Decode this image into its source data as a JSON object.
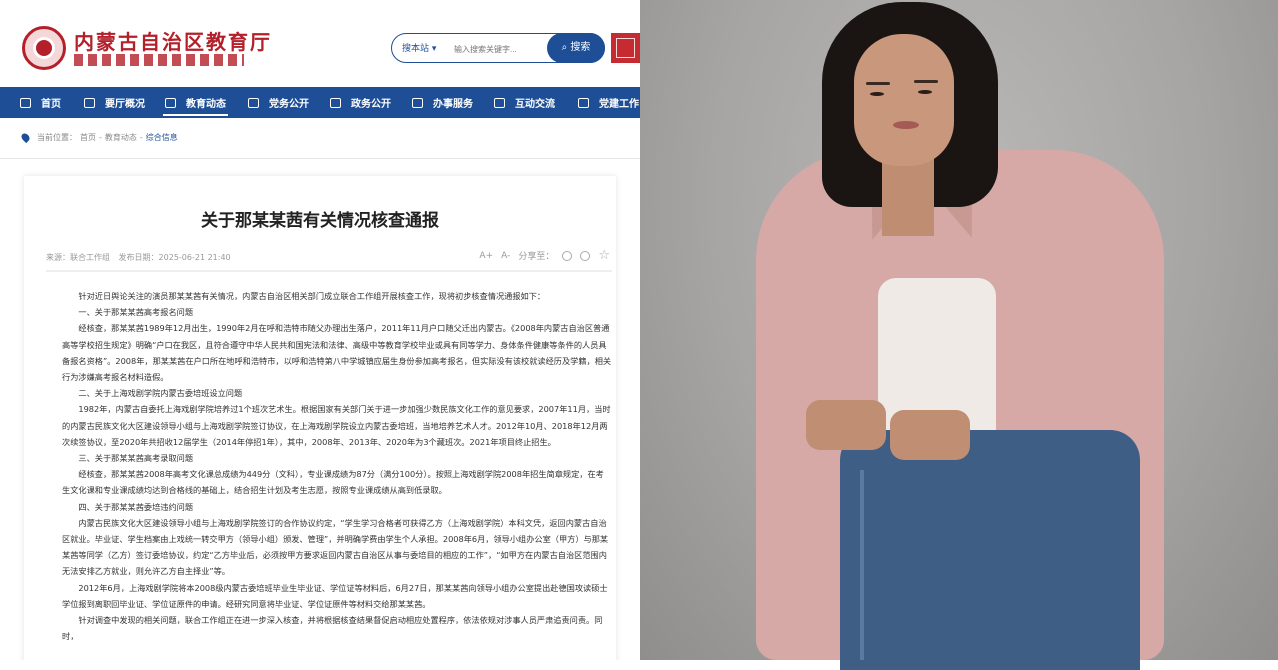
{
  "site": {
    "name": "内蒙古自治区教育厅",
    "search": {
      "scope": "搜本站 ▾",
      "placeholder": "输入搜索关键字...",
      "button": "搜索"
    }
  },
  "nav": [
    "首页",
    "要厅概况",
    "教育动态",
    "党务公开",
    "政务公开",
    "办事服务",
    "互动交流",
    "党建工作"
  ],
  "breadcrumb": {
    "label": "当前位置：",
    "path1": "首页",
    "sep": "-",
    "path2": "教育动态",
    "path3": "综合信息"
  },
  "article": {
    "title": "关于那某某茜有关情况核查通报",
    "meta": {
      "source": "来源：联合工作组",
      "date": "发布日期：2025-06-21 21:40"
    },
    "tools": {
      "font_up": "A+",
      "font_down": "A-",
      "share": "分享至："
    },
    "paragraphs": [
      "针对近日舆论关注的演员那某某茜有关情况，内蒙古自治区相关部门成立联合工作组开展核查工作，现将初步核查情况通报如下：",
      "一、关于那某某茜高考报名问题",
      "经核查，那某某茜1989年12月出生，1990年2月在呼和浩特市随父办理出生落户，2011年11月户口随父迁出内蒙古。《2008年内蒙古自治区普通高等学校招生规定》明确“户口在我区，且符合遵守中华人民共和国宪法和法律、高级中等教育学校毕业或具有同等学力、身体条件健康等条件的人员具备报名资格”。2008年，那某某茜在户口所在地呼和浩特市，以呼和浩特第八中学城镇应届生身份参加高考报名，但实际没有该校就读经历及学籍，相关行为涉嫌高考报名材料造假。",
      "二、关于上海戏剧学院内蒙古委培班设立问题",
      "1982年，内蒙古自委托上海戏剧学院培养过1个班次艺术生。根据国家有关部门关于进一步加强少数民族文化工作的意见要求，2007年11月，当时的内蒙古民族文化大区建设领导小组与上海戏剧学院签订协议，在上海戏剧学院设立内蒙古委培班，当地培养艺术人才。2012年10月、2018年12月两次续签协议，至2020年共招收12届学生（2014年停招1年），其中，2008年、2013年、2020年为3个藏班次。2021年项目终止招生。",
      "三、关于那某某茜高考录取问题",
      "经核查，那某某茜2008年高考文化课总成绩为449分（文科），专业课成绩为87分（满分100分）。按照上海戏剧学院2008年招生简章规定，在考生文化课和专业课成绩均达到合格线的基础上，结合招生计划及考生志愿，按照专业课成绩从高到低录取。",
      "四、关于那某某茜委培违约问题",
      "内蒙古民族文化大区建设领导小组与上海戏剧学院签订的合作协议约定，“学生学习合格者可获得乙方（上海戏剧学院）本科文凭，返回内蒙古自治区就业。毕业证、学生档案由上戏统一转交甲方（领导小组）颁发、管理”，并明确学费由学生个人承担。2008年6月，领导小组办公室（甲方）与那某某茜等同学（乙方）签订委培协议，约定“乙方毕业后，必须按甲方要求返回内蒙古自治区从事与委培目的相应的工作”，“如甲方在内蒙古自治区范围内无法安排乙方就业，则允许乙方自主择业”等。",
      "2012年6月，上海戏剧学院将本2008级内蒙古委培班毕业生毕业证、学位证等材料后，6月27日，那某某茜向领导小组办公室提出赴德国攻读硕士学位报到离职回毕业证、学位证原件的申请。经研究同意将毕业证、学位证原件等材料交给那某某茜。",
      "针对调查中发现的相关问题，联合工作组正在进一步深入核查，并将根据核查结果督促启动相应处置程序，依法依规对涉事人员严肃追责问责。同时，"
    ]
  }
}
